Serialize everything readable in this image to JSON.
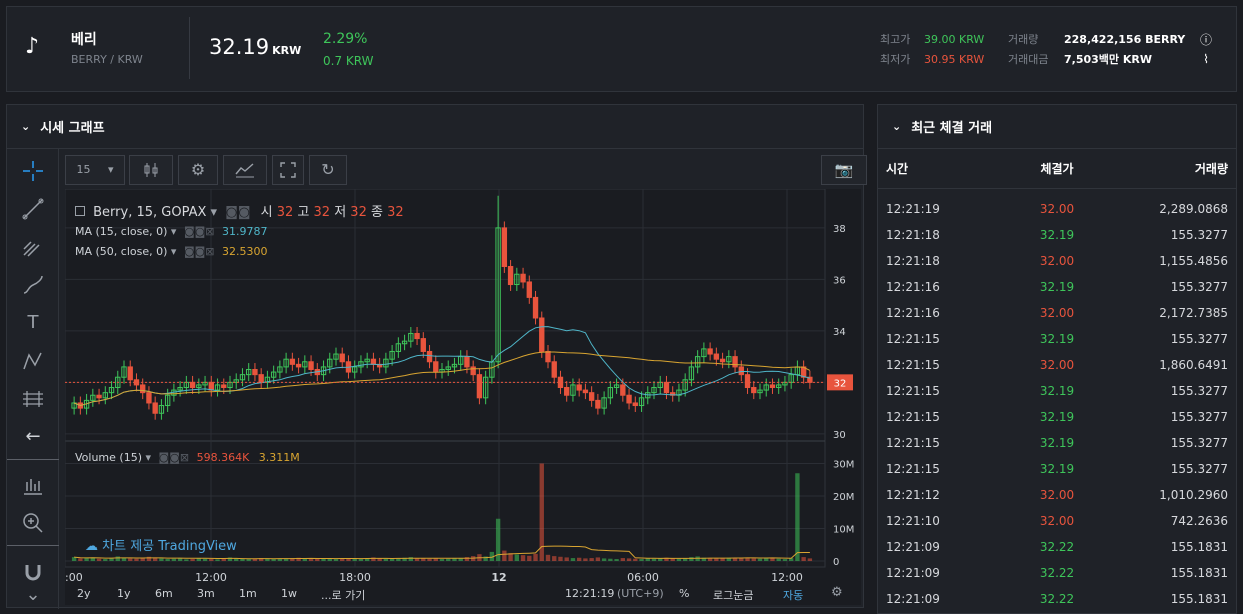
{
  "header": {
    "coin_name": "베리",
    "coin_pair": "BERRY / KRW",
    "price": "32.19",
    "price_unit": "KRW",
    "change_pct": "2.29%",
    "change_abs": "0.7 KRW",
    "high_label": "최고가",
    "high_value": "39.00 KRW",
    "low_label": "최저가",
    "low_value": "30.95 KRW",
    "volume_label": "거래량",
    "volume_value": "228,422,156 BERRY",
    "amount_label": "거래대금",
    "amount_value": "7,503백만 KRW"
  },
  "chart_panel": {
    "title": "시세 그래프",
    "interval": "15",
    "legend_main": "Berry, 15, GOPAX",
    "ohlc": {
      "o_label": "시",
      "o": "32",
      "h_label": "고",
      "h": "32",
      "l_label": "저",
      "l": "32",
      "c_label": "종",
      "c": "32"
    },
    "ma15_label": "MA (15, close, 0)",
    "ma15_value": "31.9787",
    "ma50_label": "MA (50, close, 0)",
    "ma50_value": "32.5300",
    "volume_label": "Volume (15)",
    "volume_v1": "598.364K",
    "volume_v2": "3.311M",
    "watermark": "차트 제공 TradingView",
    "last_price_tag": "32",
    "price_ticks": [
      "38",
      "36",
      "34",
      "32",
      "30"
    ],
    "volume_ticks": [
      "30M",
      "20M",
      "10M",
      "0"
    ],
    "time_ticks": [
      ":00",
      "12:00",
      "18:00",
      "12",
      "06:00",
      "12:00"
    ],
    "ranges": [
      "2y",
      "1y",
      "6m",
      "3m",
      "1m",
      "1w"
    ],
    "goto": "...로 가기",
    "clock": "12:21:19",
    "tz": "(UTC+9)",
    "pct": "%",
    "log": "로그눈금",
    "auto": "자동"
  },
  "chart_data": {
    "type": "candlestick",
    "series_ohlc": "15-minute candles BERRY/KRW",
    "ylim": [
      29.8,
      39.2
    ],
    "close": [
      31.2,
      31.0,
      31.3,
      31.5,
      31.4,
      31.6,
      31.8,
      32.2,
      32.6,
      32.1,
      31.9,
      31.6,
      31.2,
      30.8,
      31.1,
      31.5,
      31.7,
      31.8,
      32.0,
      31.8,
      31.9,
      32.0,
      31.7,
      31.9,
      31.8,
      32.0,
      32.1,
      32.3,
      32.5,
      32.3,
      32.0,
      32.2,
      32.4,
      32.6,
      32.9,
      32.7,
      32.6,
      32.8,
      32.5,
      32.3,
      32.6,
      32.9,
      33.1,
      32.8,
      32.4,
      32.6,
      32.8,
      32.9,
      32.7,
      32.6,
      32.9,
      33.2,
      33.5,
      33.6,
      33.9,
      33.7,
      33.2,
      32.8,
      32.4,
      32.5,
      32.6,
      32.7,
      33.0,
      32.6,
      32.3,
      31.4,
      32.2,
      32.8,
      38.0,
      36.5,
      35.8,
      36.2,
      35.9,
      35.3,
      34.5,
      33.2,
      32.8,
      32.2,
      31.8,
      31.5,
      31.9,
      31.7,
      31.6,
      31.3,
      31.0,
      31.4,
      31.8,
      31.9,
      31.5,
      31.2,
      31.1,
      31.4,
      31.6,
      31.8,
      32.0,
      31.6,
      31.5,
      31.7,
      32.1,
      32.6,
      33.0,
      33.3,
      33.1,
      32.9,
      32.8,
      33.0,
      32.6,
      32.3,
      31.8,
      31.6,
      31.7,
      31.9,
      31.8,
      31.9,
      32.0,
      32.3,
      32.6,
      32.2,
      32.0
    ],
    "volume_M": [
      1.2,
      0.8,
      0.9,
      1.1,
      0.7,
      0.6,
      0.9,
      1.4,
      1.0,
      0.8,
      0.7,
      0.9,
      1.3,
      1.1,
      0.8,
      0.6,
      0.7,
      0.9,
      0.5,
      0.6,
      0.8,
      0.7,
      0.6,
      0.5,
      0.9,
      1.1,
      0.8,
      0.7,
      0.6,
      0.7,
      0.9,
      0.8,
      0.6,
      0.7,
      0.8,
      0.9,
      1.0,
      0.7,
      0.6,
      0.8,
      0.9,
      0.7,
      0.6,
      0.8,
      0.9,
      0.7,
      0.6,
      0.8,
      1.1,
      0.9,
      0.7,
      0.8,
      0.9,
      1.0,
      1.2,
      0.9,
      0.8,
      0.7,
      0.9,
      0.6,
      0.7,
      0.8,
      0.9,
      1.2,
      1.5,
      2.1,
      1.4,
      2.8,
      13.0,
      3.2,
      2.4,
      2.0,
      1.8,
      1.6,
      2.2,
      30.0,
      1.9,
      1.5,
      1.3,
      1.1,
      0.9,
      1.0,
      0.8,
      0.9,
      1.1,
      0.8,
      0.7,
      0.6,
      0.9,
      0.8,
      0.7,
      0.6,
      0.8,
      0.7,
      0.9,
      1.0,
      0.8,
      0.7,
      0.9,
      1.2,
      1.4,
      1.0,
      0.9,
      0.8,
      0.9,
      1.0,
      0.8,
      0.9,
      1.1,
      0.8,
      0.7,
      0.9,
      0.8,
      0.7,
      0.6,
      0.9,
      27.0,
      1.2,
      0.8
    ]
  },
  "trades": {
    "title": "최근 체결 거래",
    "col_time": "시간",
    "col_price": "체결가",
    "col_amount": "거래량",
    "rows": [
      {
        "time": "12:21:19",
        "price": "32.00",
        "amount": "2,289.0868",
        "dir": "down"
      },
      {
        "time": "12:21:18",
        "price": "32.19",
        "amount": "155.3277",
        "dir": "up"
      },
      {
        "time": "12:21:18",
        "price": "32.00",
        "amount": "1,155.4856",
        "dir": "down"
      },
      {
        "time": "12:21:16",
        "price": "32.19",
        "amount": "155.3277",
        "dir": "up"
      },
      {
        "time": "12:21:16",
        "price": "32.00",
        "amount": "2,172.7385",
        "dir": "down"
      },
      {
        "time": "12:21:15",
        "price": "32.19",
        "amount": "155.3277",
        "dir": "up"
      },
      {
        "time": "12:21:15",
        "price": "32.00",
        "amount": "1,860.6491",
        "dir": "down"
      },
      {
        "time": "12:21:15",
        "price": "32.19",
        "amount": "155.3277",
        "dir": "up"
      },
      {
        "time": "12:21:15",
        "price": "32.19",
        "amount": "155.3277",
        "dir": "up"
      },
      {
        "time": "12:21:15",
        "price": "32.19",
        "amount": "155.3277",
        "dir": "up"
      },
      {
        "time": "12:21:15",
        "price": "32.19",
        "amount": "155.3277",
        "dir": "up"
      },
      {
        "time": "12:21:12",
        "price": "32.00",
        "amount": "1,010.2960",
        "dir": "down"
      },
      {
        "time": "12:21:10",
        "price": "32.00",
        "amount": "742.2636",
        "dir": "down"
      },
      {
        "time": "12:21:09",
        "price": "32.22",
        "amount": "155.1831",
        "dir": "up"
      },
      {
        "time": "12:21:09",
        "price": "32.22",
        "amount": "155.1831",
        "dir": "up"
      },
      {
        "time": "12:21:09",
        "price": "32.22",
        "amount": "155.1831",
        "dir": "up"
      }
    ]
  },
  "colors": {
    "up": "#3ec55a",
    "down": "#e8543d",
    "ma15": "#4fb5c8",
    "ma50": "#d9a531"
  }
}
